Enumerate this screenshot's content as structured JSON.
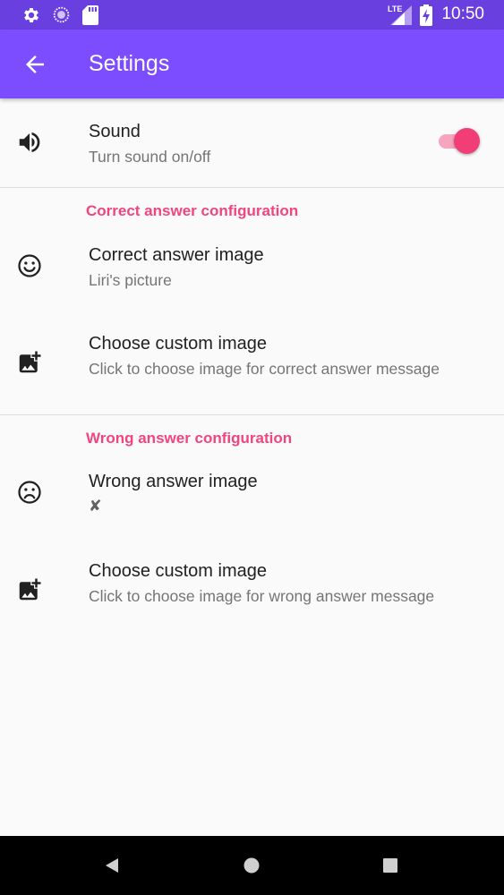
{
  "status_bar": {
    "time": "10:50",
    "network": "LTE",
    "icons": [
      "settings-icon",
      "sync-icon",
      "sd-card-icon",
      "lte-signal-icon",
      "battery-charging-icon"
    ]
  },
  "app_bar": {
    "title": "Settings",
    "back_icon": "arrow-back-icon"
  },
  "sound": {
    "title": "Sound",
    "summary": "Turn sound on/off",
    "enabled": true,
    "icon": "volume-icon"
  },
  "correct_section": {
    "header": "Correct answer configuration",
    "image_pref": {
      "title": "Correct answer image",
      "summary": "Liri's picture",
      "icon": "smiley-icon"
    },
    "custom_pref": {
      "title": "Choose custom image",
      "summary": "Click to choose image for correct answer message",
      "icon": "add-photo-icon"
    }
  },
  "wrong_section": {
    "header": "Wrong answer configuration",
    "image_pref": {
      "title": "Wrong answer image",
      "summary": "✘",
      "icon": "sad-face-icon"
    },
    "custom_pref": {
      "title": "Choose custom image",
      "summary": "Click to choose image for wrong answer message",
      "icon": "add-photo-icon"
    }
  },
  "nav_bar": {
    "buttons": [
      "back-triangle-icon",
      "home-circle-icon",
      "recents-square-icon"
    ]
  },
  "colors": {
    "primary": "#7c4dff",
    "primary_dark": "#6a3fe0",
    "accent": "#f23e77",
    "category": "#f0457d"
  }
}
